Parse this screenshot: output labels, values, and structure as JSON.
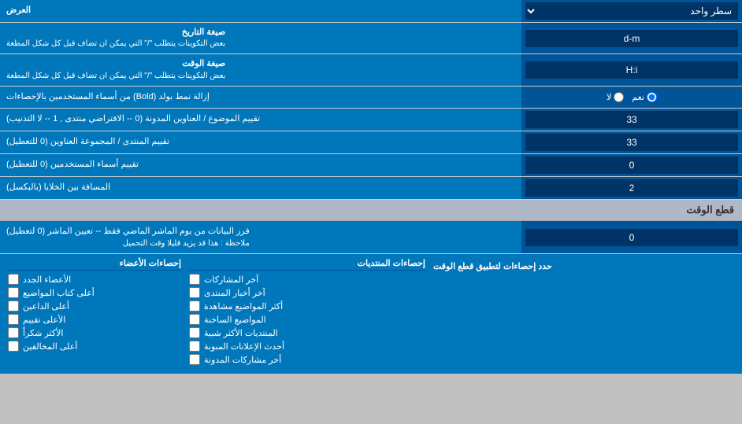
{
  "header": {
    "display_label": "العرض",
    "display_option": "سطر واحد"
  },
  "rows": [
    {
      "id": "date_format",
      "label": "صيغة التاريخ",
      "sublabel": "بعض التكوينات يتطلب \"/\" التي يمكن ان تضاف قبل كل شكل المطعة",
      "value": "d-m"
    },
    {
      "id": "time_format",
      "label": "صيغة الوقت",
      "sublabel": "بعض التكوينات يتطلب \"/\" التي يمكن ان تضاف قبل كل شكل المطعة",
      "value": "H:i"
    },
    {
      "id": "bold_remove",
      "label": "إزالة نمط بولد (Bold) من أسماء المستخدمين بالإحصاءات",
      "type": "radio",
      "options": [
        "نعم",
        "لا"
      ],
      "selected": "نعم"
    },
    {
      "id": "topic_sort",
      "label": "تقييم الموضوع / العناوين المدونة (0 -- الافتراضي منتدى , 1 -- لا التذنيب)",
      "value": "33"
    },
    {
      "id": "forum_sort",
      "label": "تقييم المنتدى / المجموعة العناوين (0 للتعطيل)",
      "value": "33"
    },
    {
      "id": "usernames_sort",
      "label": "تقييم أسماء المستخدمين (0 للتعطيل)",
      "value": "0"
    },
    {
      "id": "cell_spacing",
      "label": "المسافة بين الخلايا (بالبكسل)",
      "value": "2"
    }
  ],
  "section_cutoff": {
    "title": "قطع الوقت",
    "rows": [
      {
        "id": "data_filter",
        "label": "فرز البيانات من يوم الماشر الماضي فقط -- تعيين الماشر (0 لتعطيل)",
        "note": "ملاحظة : هذا قد يزيد قليلا وقت التحميل",
        "value": "0"
      }
    ]
  },
  "stats": {
    "apply_label": "حدد إحصاءات لتطبيق قطع الوقت",
    "col_posts_header": "إحصاءات المنتديات",
    "col_members_header": "إحصاءات الأعضاء",
    "posts_items": [
      "آخر المشاركات",
      "آخر أخبار المنتدى",
      "أكثر المواضيع مشاهدة",
      "المواضيع الساخنة",
      "المنتديات الأكثر شبية",
      "أحدث الإعلانات المبوبة",
      "أخر مشاركات المدونة"
    ],
    "members_items": [
      "الأعضاء الجدد",
      "أعلى كتاب المواضيع",
      "أعلى الداعين",
      "الأعلى تقييم",
      "الأكثر شكراً",
      "أعلى المخالفين"
    ]
  }
}
